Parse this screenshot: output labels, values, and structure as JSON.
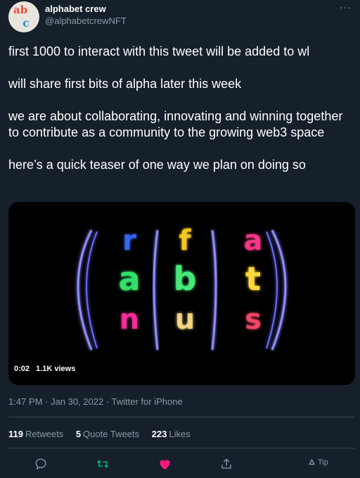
{
  "author": {
    "display_name": "alphabet crew",
    "handle": "@alphabetcrewNFT",
    "avatar_letters": [
      "ab",
      "c"
    ]
  },
  "more_label": "···",
  "tweet": {
    "text": "first 1000 to interact with this tweet will be added to wl\n\nwill share first bits of alpha later this week\n\nwe are about collaborating, innovating and winning together to contribute as a community to the growing web3 space\n\nhere’s a quick teaser of one way we plan on doing so"
  },
  "media": {
    "duration": "0:02",
    "views": "1.1K views",
    "reels": [
      {
        "letters": [
          "r",
          "a",
          "n"
        ],
        "colors": [
          "#3a6cff",
          "#33e06b",
          "#ff2fa0"
        ]
      },
      {
        "letters": [
          "f",
          "b",
          "u"
        ],
        "colors": [
          "#ffcf2a",
          "#46e87a",
          "#ffe08a"
        ]
      },
      {
        "letters": [
          "a",
          "t",
          "s"
        ],
        "colors": [
          "#ff3b8d",
          "#ffd93a",
          "#ff4a6b"
        ]
      }
    ]
  },
  "meta": {
    "time": "1:47 PM",
    "date": "Jan 30, 2022",
    "source": "Twitter for iPhone"
  },
  "stats": {
    "retweets_count": "119",
    "retweets_label": "Retweets",
    "quote_count": "5",
    "quote_label": "Quote Tweets",
    "likes_count": "223",
    "likes_label": "Likes"
  },
  "actions": {
    "reply_icon": "comment-icon",
    "retweet_icon": "retweet-icon",
    "like_icon": "heart-icon",
    "share_icon": "share-icon",
    "tip_label": "Tip"
  },
  "colors": {
    "background": "#15202b",
    "secondary_text": "#8b98a5",
    "retweet_active": "#00ba7c",
    "like_active": "#f91880"
  }
}
